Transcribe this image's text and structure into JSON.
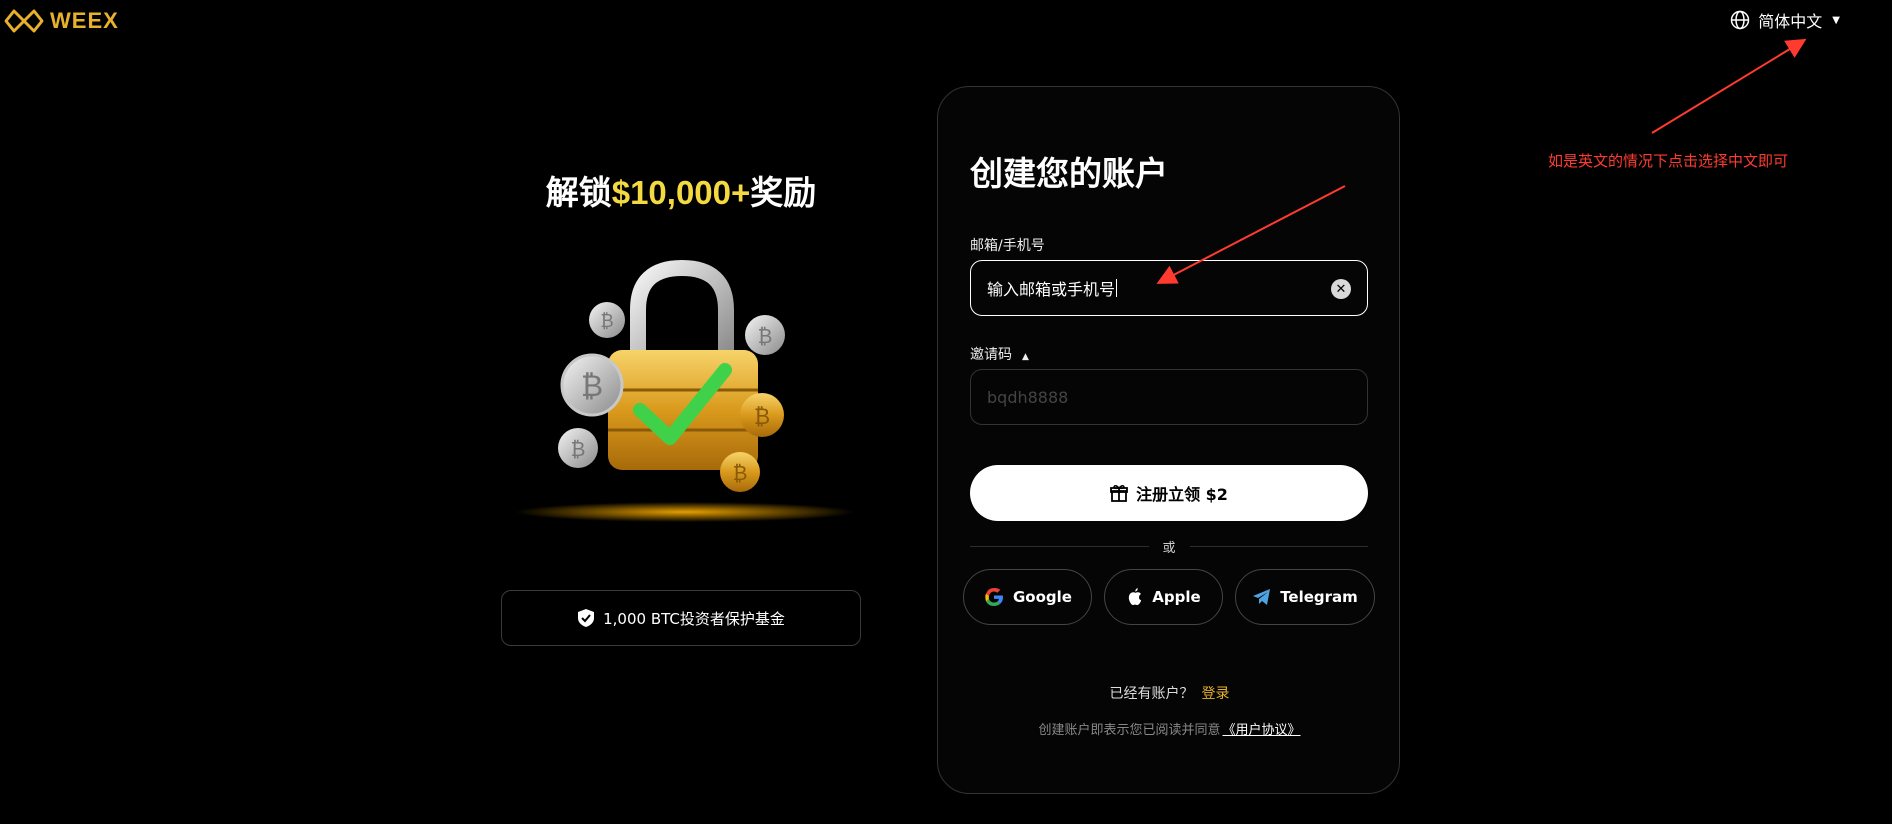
{
  "header": {
    "logo_text": "WEEX",
    "language_label": "简体中文"
  },
  "promo": {
    "title_prefix": "解锁",
    "title_highlight": "$10,000+",
    "title_suffix": "奖励",
    "fund_text": "1,000 BTC投资者保护基金"
  },
  "form": {
    "title": "创建您的账户",
    "email_label": "邮箱/手机号",
    "email_value": "输入邮箱或手机号",
    "invite_label": "邀请码",
    "invite_placeholder": "bqdh8888",
    "signup_label": "注册立领 $2",
    "or_label": "或",
    "social": {
      "google": "Google",
      "apple": "Apple",
      "telegram": "Telegram"
    },
    "have_account": "已经有账户？",
    "login_label": "登录",
    "terms_text": "创建账户即表示您已阅读并同意",
    "terms_link": "《用户协议》"
  },
  "annotation": {
    "note": "如是英文的情况下点击选择中文即可",
    "color": "#ff3b30"
  },
  "colors": {
    "brand": "#e8b12c",
    "highlight": "#f5d940",
    "background": "#000000"
  }
}
